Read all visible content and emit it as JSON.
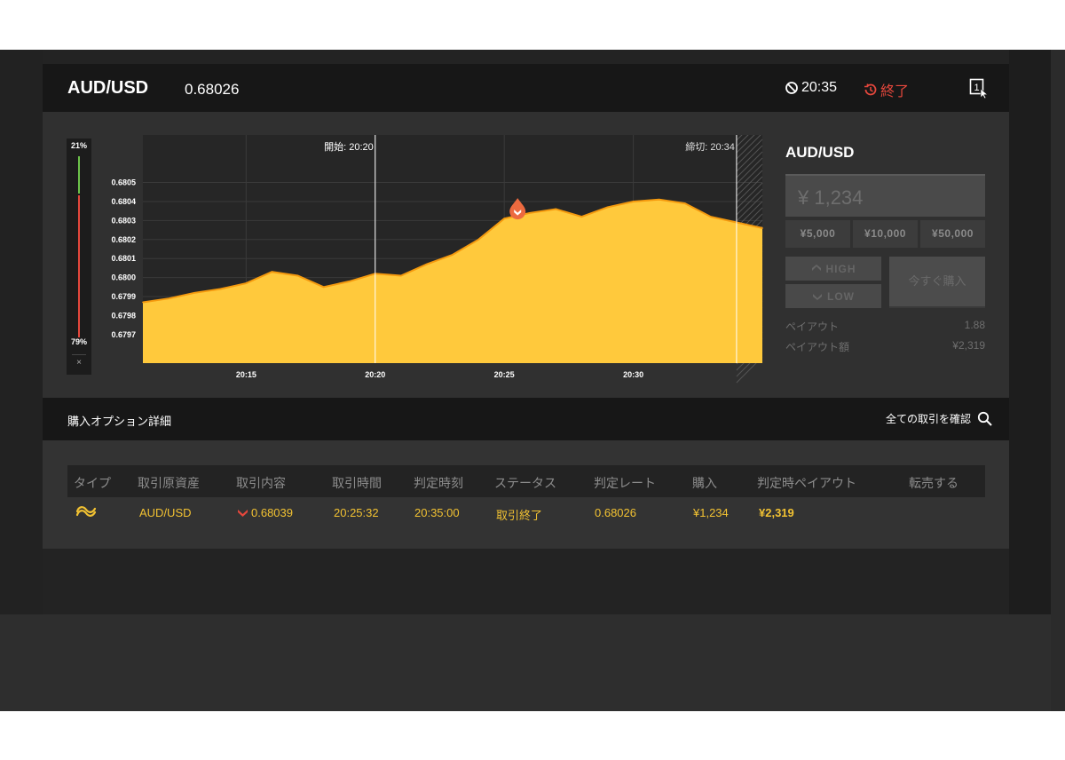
{
  "header": {
    "pair": "AUD/USD",
    "rate": "0.68026",
    "timer": "20:35",
    "status": "終了"
  },
  "sentiment": {
    "high_pct": "21%",
    "low_pct": "79%",
    "close": "×"
  },
  "chart": {
    "start_label": "開始: 20:20",
    "end_label": "締切: 20:34"
  },
  "chart_data": {
    "type": "area",
    "x": [
      "20:11",
      "20:12",
      "20:13",
      "20:14",
      "20:15",
      "20:16",
      "20:17",
      "20:18",
      "20:19",
      "20:20",
      "20:21",
      "20:22",
      "20:23",
      "20:24",
      "20:25",
      "20:26",
      "20:27",
      "20:28",
      "20:29",
      "20:30",
      "20:31",
      "20:32",
      "20:33",
      "20:34",
      "20:35"
    ],
    "values": [
      0.67987,
      0.67989,
      0.67992,
      0.67994,
      0.67997,
      0.68003,
      0.68001,
      0.67995,
      0.67998,
      0.68002,
      0.68001,
      0.68007,
      0.68012,
      0.6802,
      0.68031,
      0.68034,
      0.68036,
      0.68032,
      0.68037,
      0.6804,
      0.68041,
      0.68039,
      0.68032,
      0.68029,
      0.68026
    ],
    "yticks": [
      "0.6805",
      "0.6804",
      "0.6803",
      "0.6802",
      "0.6801",
      "0.6800",
      "0.6799",
      "0.6798",
      "0.6797"
    ],
    "ylim": [
      0.67955,
      0.68075
    ],
    "xticks": [
      "20:15",
      "20:20",
      "20:25",
      "20:30"
    ],
    "color": "#ffc93c",
    "stroke": "#f59a0e",
    "grid": true
  },
  "trade": {
    "title": "AUD/USD",
    "amount": "¥ 1,234",
    "quick": [
      "¥5,000",
      "¥10,000",
      "¥50,000"
    ],
    "high": "HIGH",
    "low": "LOW",
    "buy": "今すぐ購入",
    "payout_label": "ペイアウト",
    "payout_value": "1.88",
    "payout_amount_label": "ペイアウト額",
    "payout_amount_value": "¥2,319"
  },
  "options": {
    "title": "購入オプション詳細",
    "view_all": "全ての取引を確認"
  },
  "table": {
    "headers": [
      "タイプ",
      "取引原資産",
      "取引内容",
      "取引時間",
      "判定時刻",
      "ステータス",
      "判定レート",
      "購入",
      "判定時ペイアウト",
      "転売する"
    ],
    "row": {
      "asset": "AUD/USD",
      "content": "0.68039",
      "time": "20:25:32",
      "judge_time": "20:35:00",
      "status": "取引終了",
      "judge_rate": "0.68026",
      "purchase": "¥1,234",
      "payout": "¥2,319"
    }
  },
  "colors": {
    "accent": "#f2c232",
    "danger": "#e4473c",
    "up": "#6cc24a"
  }
}
